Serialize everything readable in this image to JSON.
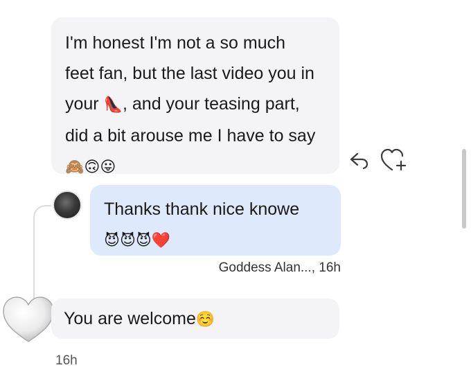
{
  "message_1": {
    "lines": [
      "I'm honest I'm not a so much",
      "feet fan, but the last video you in",
      "your",
      ", and your teasing part,",
      "did a bit arouse me I have to say"
    ],
    "emojis": [
      "🙈",
      "🙃",
      "😛"
    ],
    "inline_emoji": "👠"
  },
  "message_2": {
    "text": "Thanks thank nice knowe",
    "emojis": [
      "😈",
      "😈",
      "😈",
      "❤️"
    ]
  },
  "message_2_meta": "Goddess Alan..., 16h",
  "message_3": {
    "text": "You are welcome",
    "emoji": "☺️"
  },
  "message_3_meta": "16h",
  "icons": {
    "reply": "reply-icon",
    "like": "heart-plus-icon",
    "avatar_reaction": "white-heart-icon"
  },
  "colors": {
    "incoming_bubble": "#f4f4f6",
    "outgoing_bubble": "#deeafb"
  }
}
